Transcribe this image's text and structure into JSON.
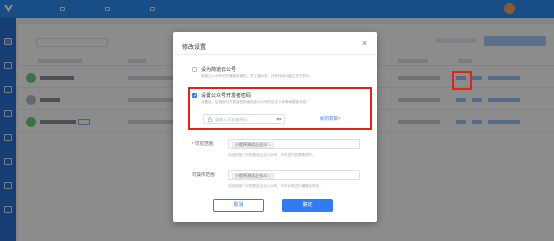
{
  "colors": {
    "primary": "#2f7cf6",
    "highlight": "#e2231a",
    "wechat_green": "#6bd07e"
  },
  "modal": {
    "title": "修改设置",
    "close_icon": "close-icon",
    "option_basic": {
      "checked": false,
      "label": "设为简道云公号",
      "desc": "简道云公众号可开通微信通知，员工通讯录，还有持续功能正在开放中。"
    },
    "option_dev": {
      "checked": true,
      "label": "设置公众号开发者密码",
      "desc": "设置后，后端即可开放者密码使用该公众号的自定义菜单和模板消息。",
      "password_placeholder": "请输入开发者密码",
      "help_link": "如何获取?"
    },
    "visible_range": {
      "label": "可见范围:",
      "chip": "小程序测试企业22",
      "hint": "勾选的部门可查看该企业公众号，不可进行权限等操作。"
    },
    "operate_range": {
      "label": "可操作范围:",
      "chip": "小程序测试企业22",
      "hint": "勾选的部门可查看该企业公众号，不可对其进行编辑及修改。"
    },
    "cancel_label": "取消",
    "confirm_label": "确定"
  }
}
